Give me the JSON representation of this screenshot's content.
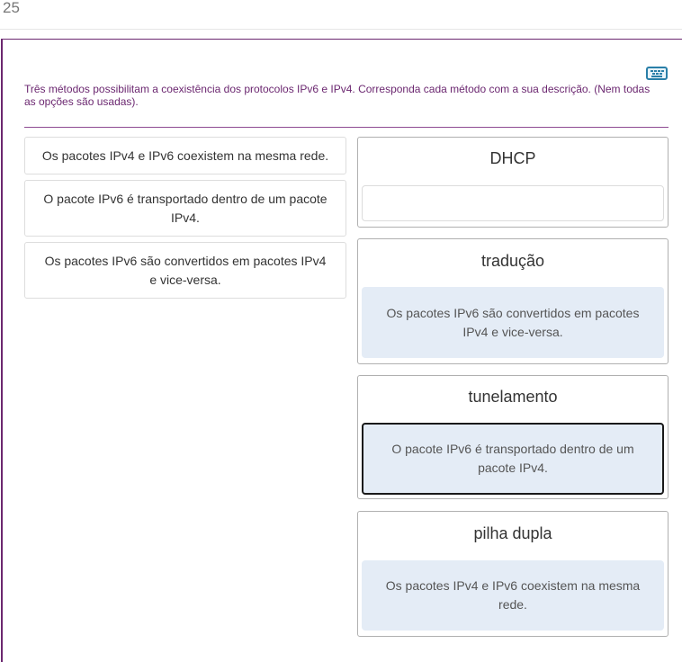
{
  "question": {
    "number": "25",
    "instruction": "Três métodos possibilitam a coexistência dos protocolos IPv6 e IPv4. Corresponda cada método com a sua descrição. (Nem todas as opções são usadas)."
  },
  "options": [
    {
      "text": "Os pacotes IPv4 e IPv6 coexistem na mesma rede."
    },
    {
      "text": "O pacote IPv6 é transportado dentro de um pacote IPv4."
    },
    {
      "text": "Os pacotes IPv6 são convertidos em pacotes IPv4 e vice-versa."
    }
  ],
  "targets": [
    {
      "title": "DHCP",
      "answer": ""
    },
    {
      "title": "tradução",
      "answer": "Os pacotes IPv6 são convertidos em pacotes IPv4 e vice-versa."
    },
    {
      "title": "tunelamento",
      "answer": "O pacote IPv6 é transportado dentro de um pacote IPv4."
    },
    {
      "title": "pilha dupla",
      "answer": "Os pacotes IPv4 e IPv6 coexistem na mesma rede."
    }
  ],
  "icons": {
    "keyboard": "keyboard-icon"
  },
  "colors": {
    "accent": "#6b2770",
    "drop_zone": "#e4ecf6",
    "keyboard_icon": "#2a7fa8"
  }
}
